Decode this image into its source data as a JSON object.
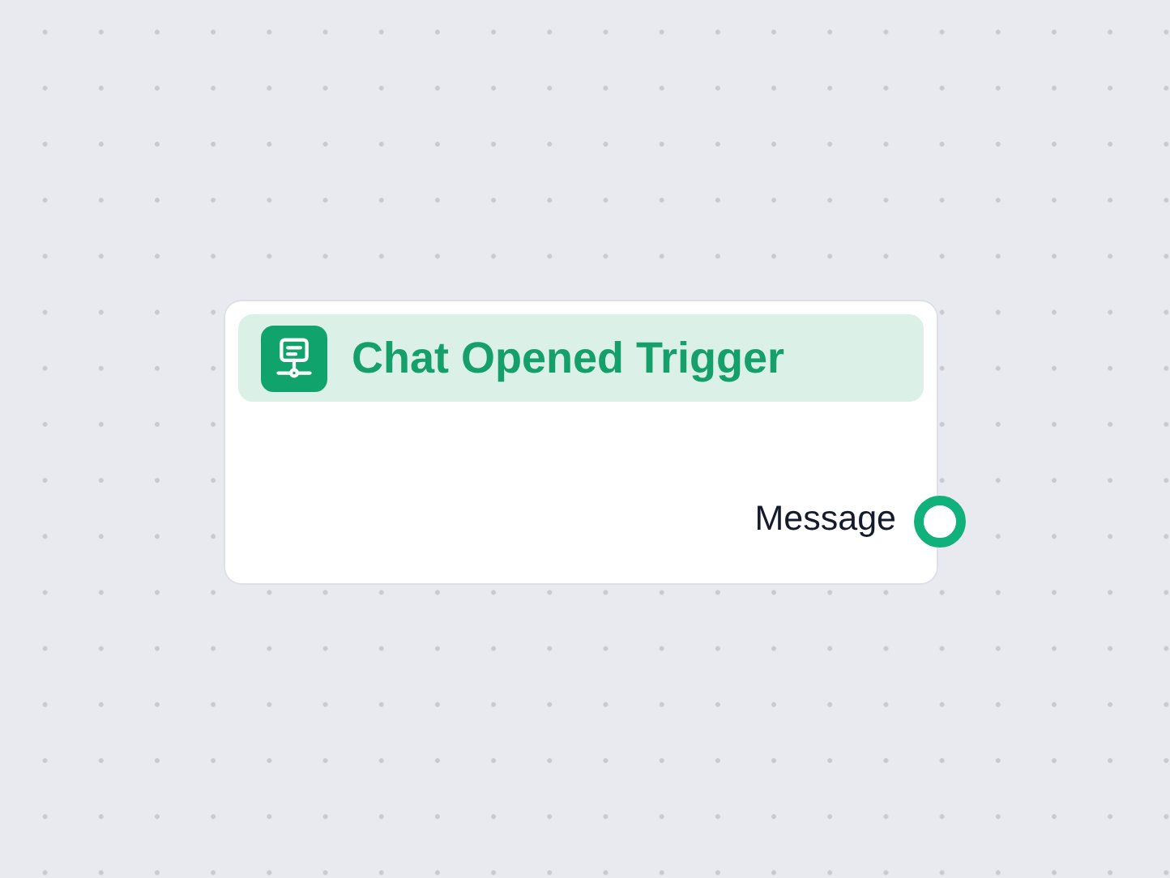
{
  "node": {
    "title": "Chat Opened Trigger",
    "outputs": [
      {
        "label": "Message"
      }
    ]
  }
}
